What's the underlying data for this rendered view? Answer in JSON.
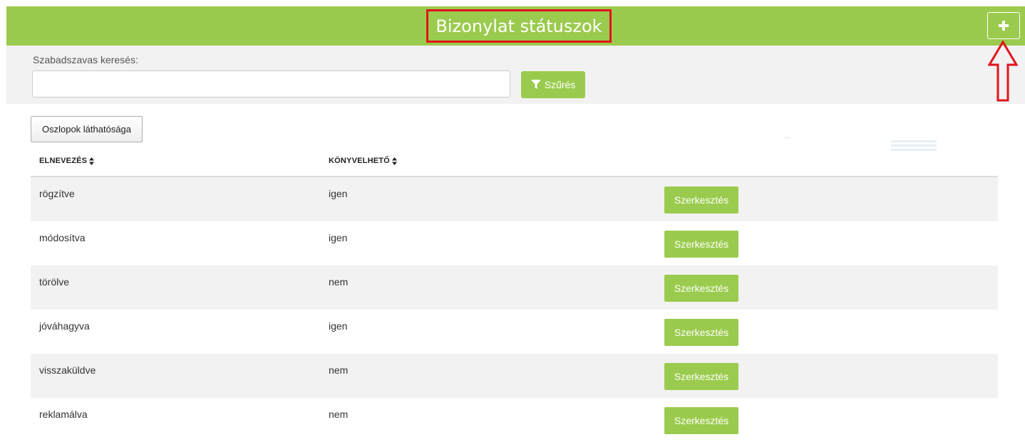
{
  "header": {
    "title": "Bizonylat státuszok",
    "add_button_icon": "plus-icon",
    "bg_color": "#9bcb4e",
    "highlight_color": "#e0141b"
  },
  "search": {
    "label": "Szabadszavas keresés:",
    "value": "",
    "placeholder": "",
    "filter_button_label": "Szűrés",
    "filter_icon": "filter-icon"
  },
  "columns_button_label": "Oszlopok láthatósága",
  "table": {
    "columns": [
      {
        "label": "ELNEVEZÉS",
        "sort_icon": "sort-icon"
      },
      {
        "label": "KÖNYVELHETŐ",
        "sort_icon": "sort-icon"
      }
    ],
    "rows": [
      {
        "name": "rögzítve",
        "bookable": "igen",
        "action": "Szerkesztés"
      },
      {
        "name": "módosítva",
        "bookable": "igen",
        "action": "Szerkesztés"
      },
      {
        "name": "törölve",
        "bookable": "nem",
        "action": "Szerkesztés"
      },
      {
        "name": "jóváhagyva",
        "bookable": "igen",
        "action": "Szerkesztés"
      },
      {
        "name": "visszaküldve",
        "bookable": "nem",
        "action": "Szerkesztés"
      },
      {
        "name": "reklamálva",
        "bookable": "nem",
        "action": "Szerkesztés"
      }
    ]
  },
  "annotation": {
    "arrow_icon": "up-arrow-icon"
  }
}
